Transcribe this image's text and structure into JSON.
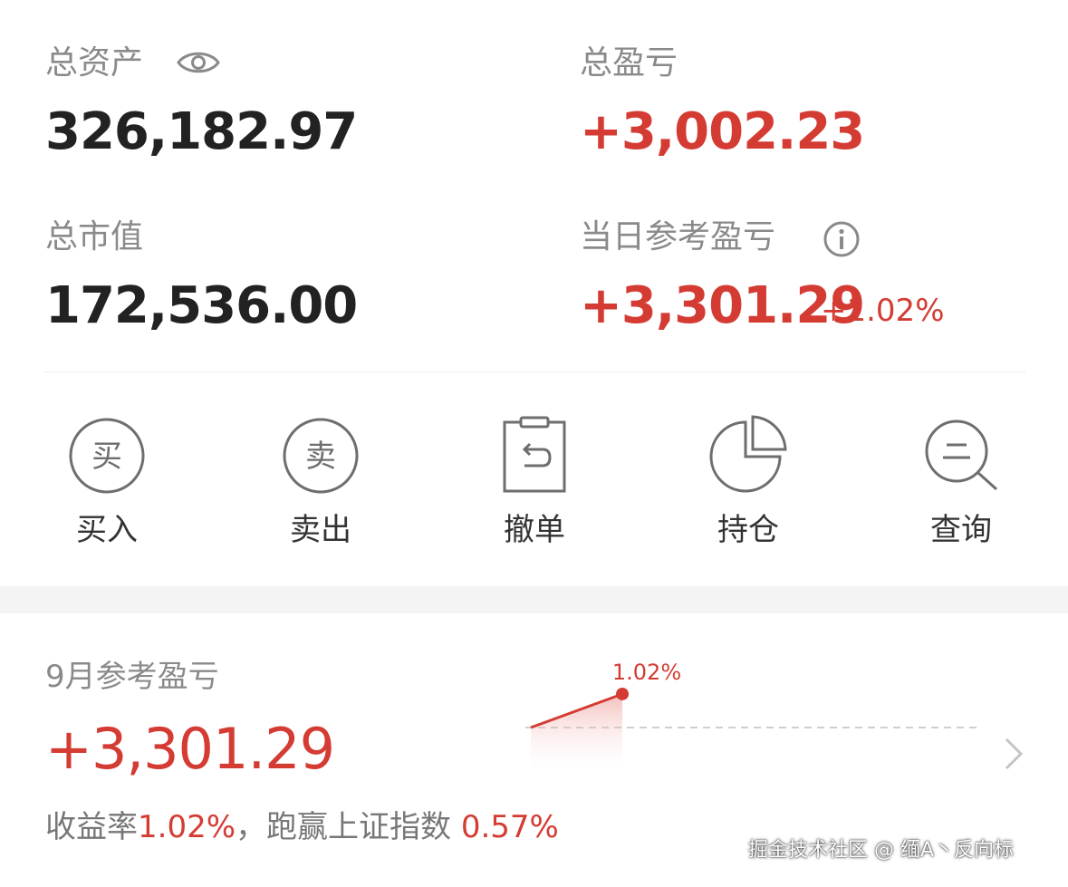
{
  "summary": {
    "total_assets_label": "总资产",
    "total_assets_value": "326,182.97",
    "total_pnl_label": "总盈亏",
    "total_pnl_value": "+3,002.23",
    "market_value_label": "总市值",
    "market_value_value": "172,536.00",
    "daily_pnl_label": "当日参考盈亏",
    "daily_pnl_value": "+3,301.29",
    "daily_pnl_pct": "+1.02%"
  },
  "actions": [
    {
      "label": "买入",
      "icon_char": "买",
      "icon": "buy-icon"
    },
    {
      "label": "卖出",
      "icon_char": "卖",
      "icon": "sell-icon"
    },
    {
      "label": "撤单",
      "icon": "cancel-order-icon"
    },
    {
      "label": "持仓",
      "icon": "pie-chart-icon"
    },
    {
      "label": "查询",
      "icon": "search-icon"
    }
  ],
  "monthly": {
    "label": "9月参考盈亏",
    "value": "+3,301.29",
    "return_label": "收益率",
    "return_value": "1.02%",
    "separator": "，",
    "beat_label": "跑赢上证指数",
    "beat_value": "0.57%"
  },
  "chart_data": {
    "type": "line",
    "series": [
      {
        "values": [
          0,
          1.02
        ]
      }
    ],
    "point_labels": [
      "",
      "1.02%"
    ],
    "baseline": 0
  },
  "watermark": "掘金技术社区 @ 缅A丶反向标",
  "colors": {
    "profit_red": "#d43c33",
    "text_dark": "#222222",
    "label_gray": "#8a8a8a",
    "icon_gray": "#6e6e6e"
  }
}
